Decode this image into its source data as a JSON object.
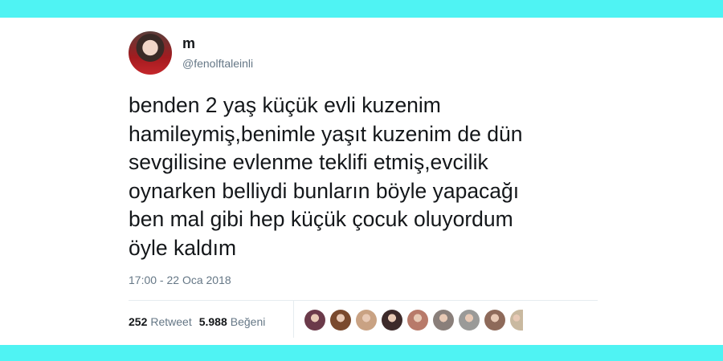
{
  "tweet": {
    "display_name": "m",
    "handle": "@fenolftaleinli",
    "text": "benden 2 yaş küçük evli kuzenim\nhamileymiş,benimle yaşıt kuzenim de dün\nsevgilisine evlenme teklifi etmiş,evcilik\noynarken belliydi bunların böyle yapacağı\nben mal gibi hep küçük çocuk oluyordum\nöyle kaldım",
    "timestamp": "17:00 - 22 Oca 2018",
    "retweet_count": "252",
    "retweet_label": "Retweet",
    "like_count": "5.988",
    "like_label": "Beğeni"
  },
  "colors": {
    "accent_band": "#4ff3f3",
    "text_primary": "#14171a",
    "text_secondary": "#657786"
  },
  "liker_avatars": [
    {
      "name": "liker-avatar-1",
      "color": "#6b3a4a"
    },
    {
      "name": "liker-avatar-2",
      "color": "#7a4a2e"
    },
    {
      "name": "liker-avatar-3",
      "color": "#c9a283"
    },
    {
      "name": "liker-avatar-4",
      "color": "#3d2a2a"
    },
    {
      "name": "liker-avatar-5",
      "color": "#b87a6a"
    },
    {
      "name": "liker-avatar-6",
      "color": "#8a7f7a"
    },
    {
      "name": "liker-avatar-7",
      "color": "#9a9a98"
    },
    {
      "name": "liker-avatar-8",
      "color": "#8e6a5a"
    },
    {
      "name": "liker-avatar-9",
      "color": "#c9b9a0"
    }
  ]
}
